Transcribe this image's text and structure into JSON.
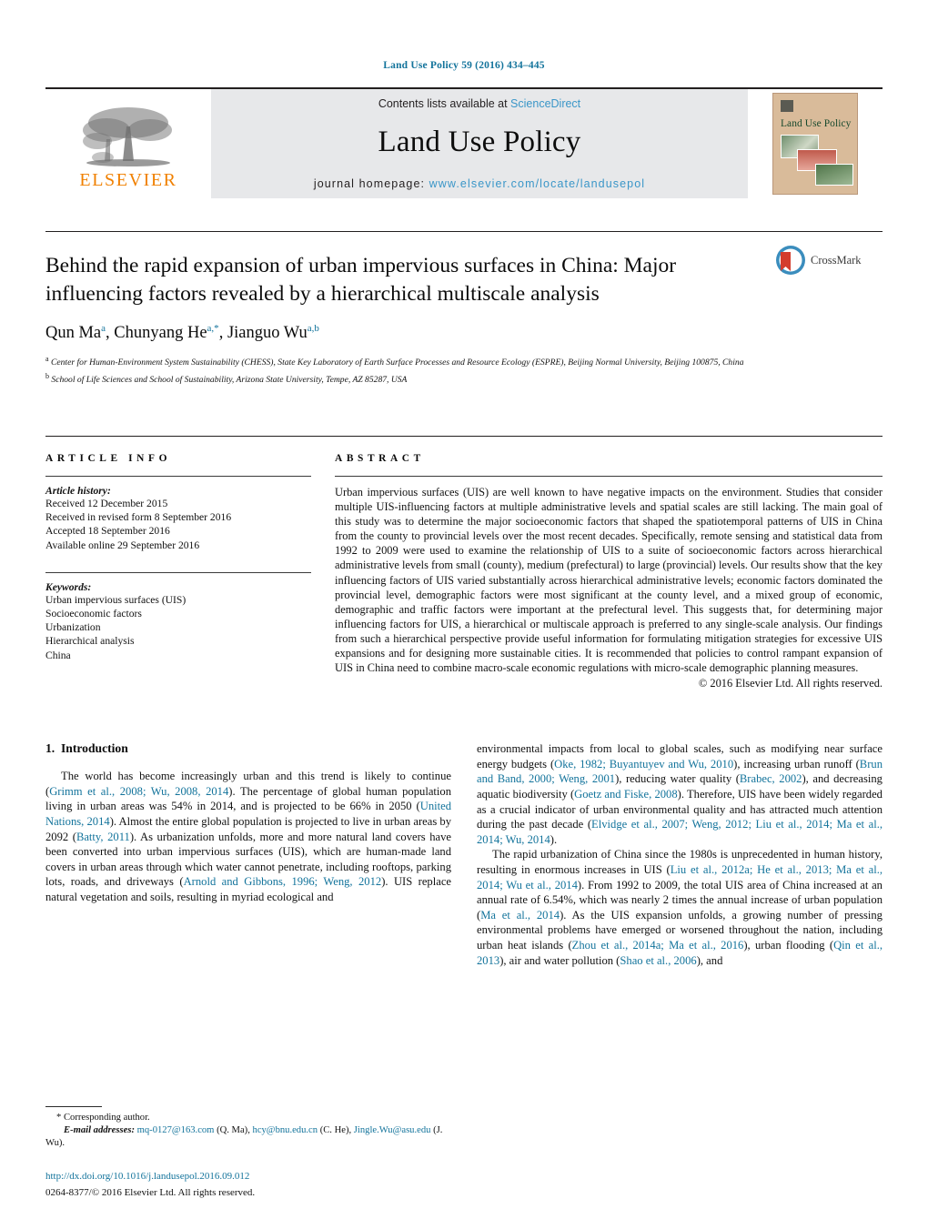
{
  "running_head": "Land Use Policy 59 (2016) 434–445",
  "masthead": {
    "publisher_logo_text": "ELSEVIER",
    "contents_prefix": "Contents lists available at ",
    "contents_link": "ScienceDirect",
    "journal_name": "Land Use Policy",
    "homepage_prefix": "journal homepage: ",
    "homepage_url": "www.elsevier.com/locate/landusepol",
    "cover_title": "Land Use Policy"
  },
  "article": {
    "title": "Behind the rapid expansion of urban impervious surfaces in China: Major influencing factors revealed by a hierarchical multiscale analysis",
    "authors": "Qun Ma a, Chunyang He a,*, Jianguo Wu a,b",
    "author_parts": [
      {
        "name": "Qun Ma",
        "sup": "a",
        "sep": ", "
      },
      {
        "name": "Chunyang He",
        "sup": "a,*",
        "sep": ", "
      },
      {
        "name": "Jianguo Wu",
        "sup": "a,b",
        "sep": ""
      }
    ],
    "affiliations": [
      {
        "marker": "a",
        "text": "Center for Human-Environment System Sustainability (CHESS), State Key Laboratory of Earth Surface Processes and Resource Ecology (ESPRE), Beijing Normal University, Beijing 100875, China"
      },
      {
        "marker": "b",
        "text": "School of Life Sciences and School of Sustainability, Arizona State University, Tempe, AZ 85287, USA"
      }
    ],
    "crossmark_label": "CrossMark"
  },
  "article_info": {
    "heading": "ARTICLE INFO",
    "history_label": "Article history:",
    "history": [
      "Received 12 December 2015",
      "Received in revised form 8 September 2016",
      "Accepted 18 September 2016",
      "Available online 29 September 2016"
    ],
    "keywords_label": "Keywords:",
    "keywords": [
      "Urban impervious surfaces (UIS)",
      "Socioeconomic factors",
      "Urbanization",
      "Hierarchical analysis",
      "China"
    ]
  },
  "abstract": {
    "heading": "ABSTRACT",
    "text": "Urban impervious surfaces (UIS) are well known to have negative impacts on the environment. Studies that consider multiple UIS-influencing factors at multiple administrative levels and spatial scales are still lacking. The main goal of this study was to determine the major socioeconomic factors that shaped the spatiotemporal patterns of UIS in China from the county to provincial levels over the most recent decades. Specifically, remote sensing and statistical data from 1992 to 2009 were used to examine the relationship of UIS to a suite of socioeconomic factors across hierarchical administrative levels from small (county), medium (prefectural) to large (provincial) levels. Our results show that the key influencing factors of UIS varied substantially across hierarchical administrative levels; economic factors dominated the provincial level, demographic factors were most significant at the county level, and a mixed group of economic, demographic and traffic factors were important at the prefectural level. This suggests that, for determining major influencing factors for UIS, a hierarchical or multiscale approach is preferred to any single-scale analysis. Our findings from such a hierarchical perspective provide useful information for formulating mitigation strategies for excessive UIS expansions and for designing more sustainable cities. It is recommended that policies to control rampant expansion of UIS in China need to combine macro-scale economic regulations with micro-scale demographic planning measures.",
    "copyright": "© 2016 Elsevier Ltd. All rights reserved."
  },
  "introduction": {
    "section_number": "1.",
    "section_title": "Introduction",
    "left_paragraph_html": "The world has become increasingly urban and this trend is likely to continue (<span class=\"ref\">Grimm et al., 2008; Wu, 2008, 2014</span>). The percentage of global human population living in urban areas was 54% in 2014, and is projected to be 66% in 2050 (<span class=\"ref\">United Nations, 2014</span>). Almost the entire global population is projected to live in urban areas by 2092 (<span class=\"ref\">Batty, 2011</span>). As urbanization unfolds, more and more natural land covers have been converted into urban impervious surfaces (UIS), which are human-made land covers in urban areas through which water cannot penetrate, including rooftops, parking lots, roads, and driveways (<span class=\"ref\">Arnold and Gibbons, 1996; Weng, 2012</span>). UIS replace natural vegetation and soils, resulting in myriad ecological and",
    "right_paragraph_1_html": "environmental impacts from local to global scales, such as modifying near surface energy budgets (<span class=\"ref\">Oke, 1982; Buyantuyev and Wu, 2010</span>), increasing urban runoff (<span class=\"ref\">Brun and Band, 2000; Weng, 2001</span>), reducing water quality (<span class=\"ref\">Brabec, 2002</span>), and decreasing aquatic biodiversity (<span class=\"ref\">Goetz and Fiske, 2008</span>). Therefore, UIS have been widely regarded as a crucial indicator of urban environmental quality and has attracted much attention during the past decade (<span class=\"ref\">Elvidge et al., 2007; Weng, 2012; Liu et al., 2014; Ma et al., 2014; Wu, 2014</span>).",
    "right_paragraph_2_html": "The rapid urbanization of China since the 1980s is unprecedented in human history, resulting in enormous increases in UIS (<span class=\"ref\">Liu et al., 2012a; He et al., 2013; Ma et al., 2014; Wu et al., 2014</span>). From 1992 to 2009, the total UIS area of China increased at an annual rate of 6.54%, which was nearly 2 times the annual increase of urban population (<span class=\"ref\">Ma et al., 2014</span>). As the UIS expansion unfolds, a growing number of pressing environmental problems have emerged or worsened throughout the nation, including urban heat islands (<span class=\"ref\">Zhou et al., 2014a; Ma et al., 2016</span>), urban flooding (<span class=\"ref\">Qin et al., 2013</span>), air and water pollution (<span class=\"ref\">Shao et al., 2006</span>), and"
  },
  "footnotes": {
    "corresponding_marker": "*",
    "corresponding_text": "Corresponding author.",
    "email_label": "E-mail addresses:",
    "emails_html": "<span class=\"ref\">mq-0127@163.com</span> (Q. Ma), <span class=\"ref\">hcy@bnu.edu.cn</span> (C. He), <span class=\"ref\">Jingle.Wu@asu.edu</span> (J. Wu).",
    "doi": "http://dx.doi.org/10.1016/j.landusepol.2016.09.012",
    "issn_copyright": "0264-8377/© 2016 Elsevier Ltd. All rights reserved."
  },
  "colors": {
    "link": "#12739b",
    "elsevier_orange": "#f08000",
    "masthead_bg": "#e7e8ea",
    "cover_bg": "#d9bb9a"
  }
}
